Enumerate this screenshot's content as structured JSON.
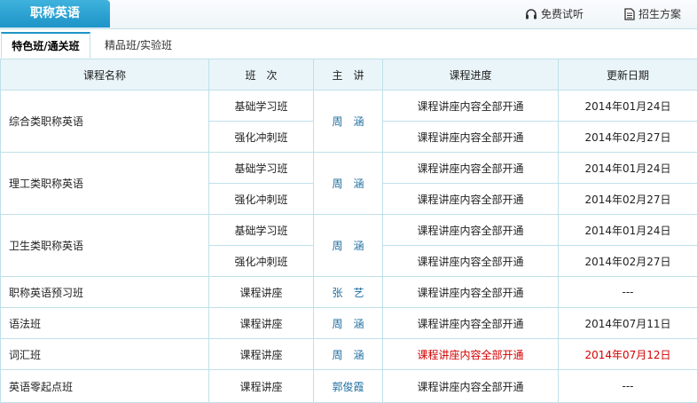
{
  "header": {
    "title": "职称英语",
    "free_trial": "免费试听",
    "enroll_plan": "招生方案"
  },
  "subtabs": [
    "特色班/通关班",
    "精品班/实验班"
  ],
  "table": {
    "headers": [
      "课程名称",
      "班　次",
      "主　讲",
      "课程进度",
      "更新日期"
    ],
    "groups": [
      {
        "course": "综合类职称英语",
        "teacher": "周　涵",
        "rows": [
          {
            "class": "基础学习班",
            "progress": "课程讲座内容全部开通",
            "date": "2014年01月24日"
          },
          {
            "class": "强化冲刺班",
            "progress": "课程讲座内容全部开通",
            "date": "2014年02月27日"
          }
        ]
      },
      {
        "course": "理工类职称英语",
        "teacher": "周　涵",
        "rows": [
          {
            "class": "基础学习班",
            "progress": "课程讲座内容全部开通",
            "date": "2014年01月24日"
          },
          {
            "class": "强化冲刺班",
            "progress": "课程讲座内容全部开通",
            "date": "2014年02月27日"
          }
        ]
      },
      {
        "course": "卫生类职称英语",
        "teacher": "周　涵",
        "rows": [
          {
            "class": "基础学习班",
            "progress": "课程讲座内容全部开通",
            "date": "2014年01月24日"
          },
          {
            "class": "强化冲刺班",
            "progress": "课程讲座内容全部开通",
            "date": "2014年02月27日"
          }
        ]
      }
    ],
    "singles": [
      {
        "course": "职称英语预习班",
        "class": "课程讲座",
        "teacher": "张　艺",
        "progress": "课程讲座内容全部开通",
        "date": "---"
      },
      {
        "course": "语法班",
        "class": "课程讲座",
        "teacher": "周　涵",
        "progress": "课程讲座内容全部开通",
        "date": "2014年07月11日"
      },
      {
        "course": "词汇班",
        "class": "课程讲座",
        "teacher": "周　涵",
        "progress": "课程讲座内容全部开通",
        "date": "2014年07月12日"
      },
      {
        "course": "英语零起点班",
        "class": "课程讲座",
        "teacher": "郭俊霞",
        "progress": "课程讲座内容全部开通",
        "date": "---"
      }
    ]
  },
  "colors": {
    "accent": "#1d94c8",
    "border": "#bfe0ea",
    "header_bg": "#eaf5f9",
    "highlight": "#d40000",
    "teacher": "#1f6ea0"
  },
  "icons": {
    "free_trial": "headphones-icon",
    "enroll_plan": "document-icon"
  }
}
